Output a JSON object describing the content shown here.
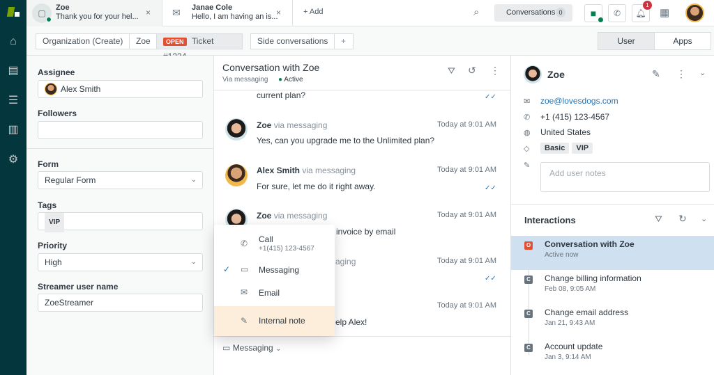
{
  "tabs": [
    {
      "name": "Zoe",
      "preview": "Thank you for your hel..."
    },
    {
      "name": "Janae Cole",
      "preview": "Hello, I am having an is..."
    }
  ],
  "add_tab": "+ Add",
  "conversations": {
    "label": "Conversations",
    "count": "0"
  },
  "notifications_count": "1",
  "breadcrumb": {
    "org": "Organization (Create)",
    "user": "Zoe",
    "status": "OPEN",
    "ticket": "Ticket #1234",
    "side": "Side conversations",
    "plus": "+"
  },
  "panel_toggle": {
    "user": "User",
    "apps": "Apps"
  },
  "fields": {
    "assignee_label": "Assignee",
    "assignee": "Alex Smith",
    "followers_label": "Followers",
    "form_label": "Form",
    "form": "Regular Form",
    "tags_label": "Tags",
    "tag": "VIP",
    "priority_label": "Priority",
    "priority": "High",
    "streamer_label": "Streamer user name",
    "streamer": "ZoeStreamer"
  },
  "conversation": {
    "title": "Conversation with Zoe",
    "via": "Via messaging",
    "status": "Active",
    "partial_text": "current plan?",
    "messages": [
      {
        "name": "Zoe",
        "via": "via messaging",
        "time": "Today at 9:01 AM",
        "text": "Yes, can you upgrade me to the Unlimited plan?"
      },
      {
        "name": "Alex Smith",
        "via": "via messaging",
        "time": "Today at 9:01 AM",
        "text": "For sure, let me do it right away."
      },
      {
        "name": "Zoe",
        "via": "via messaging",
        "time": "Today at 9:01 AM",
        "text": "invoice by email"
      },
      {
        "via": "aging",
        "time": "Today at 9:01 AM"
      },
      {
        "time": "Today at 9:01 AM",
        "text": "elp Alex!"
      }
    ]
  },
  "channel_menu": {
    "call": "Call",
    "call_number": "+1(415) 123-4567",
    "messaging": "Messaging",
    "email": "Email",
    "internal_note": "Internal note"
  },
  "composer_channel": "Messaging",
  "user": {
    "name": "Zoe",
    "email": "zoe@lovesdogs.com",
    "phone": "+1 (415) 123-4567",
    "country": "United States",
    "tags": [
      "Basic",
      "VIP"
    ],
    "notes_placeholder": "Add user notes"
  },
  "interactions": {
    "title": "Interactions",
    "items": [
      {
        "badge": "O",
        "title": "Conversation with Zoe",
        "sub": "Active now"
      },
      {
        "badge": "C",
        "title": "Change billing information",
        "sub": "Feb 08, 9:05 AM"
      },
      {
        "badge": "C",
        "title": "Change email address",
        "sub": "Jan 21, 9:43 AM"
      },
      {
        "badge": "C",
        "title": "Account update",
        "sub": "Jan 3, 9:14 AM"
      }
    ]
  },
  "colors": {
    "nav": "#03363d",
    "accent": "#1f73b7",
    "open": "#e34f32",
    "active": "#038153",
    "highlight": "#cfe1f1",
    "note": "#fdeedb"
  }
}
